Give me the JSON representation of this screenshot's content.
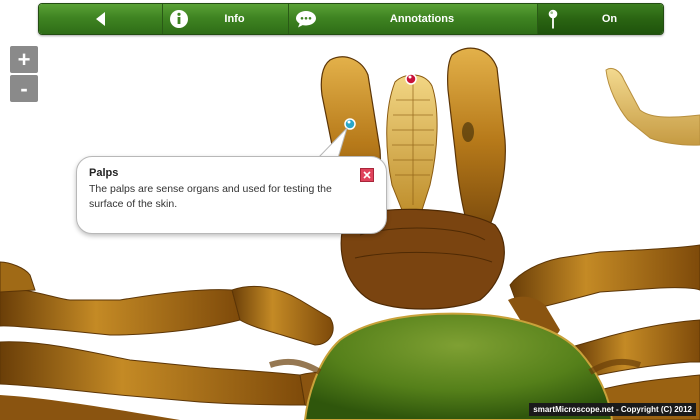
{
  "toolbar": {
    "back_icon": "back-triangle-icon",
    "info_label": "Info",
    "info_icon": "info-circle-icon",
    "annotations_label": "Annotations",
    "annotations_icon": "speech-bubble-icon",
    "pin_label": "On",
    "pin_icon": "pin-icon"
  },
  "zoom": {
    "in_label": "+",
    "out_label": "-"
  },
  "annotation": {
    "title": "Palps",
    "text": "The palps are sense organs and used for testing the surface of the skin.",
    "close_icon": "close-x-icon",
    "marker_colors": {
      "active": "#2aa7c9",
      "other": "#c8123a"
    }
  },
  "footer": {
    "copyright": "smartMicroscope.net - Copyright (C) 2012"
  },
  "colors": {
    "toolbar_green": "#3f8422",
    "callout_close": "#e0435c",
    "specimen_shield": "#4f7a12"
  }
}
